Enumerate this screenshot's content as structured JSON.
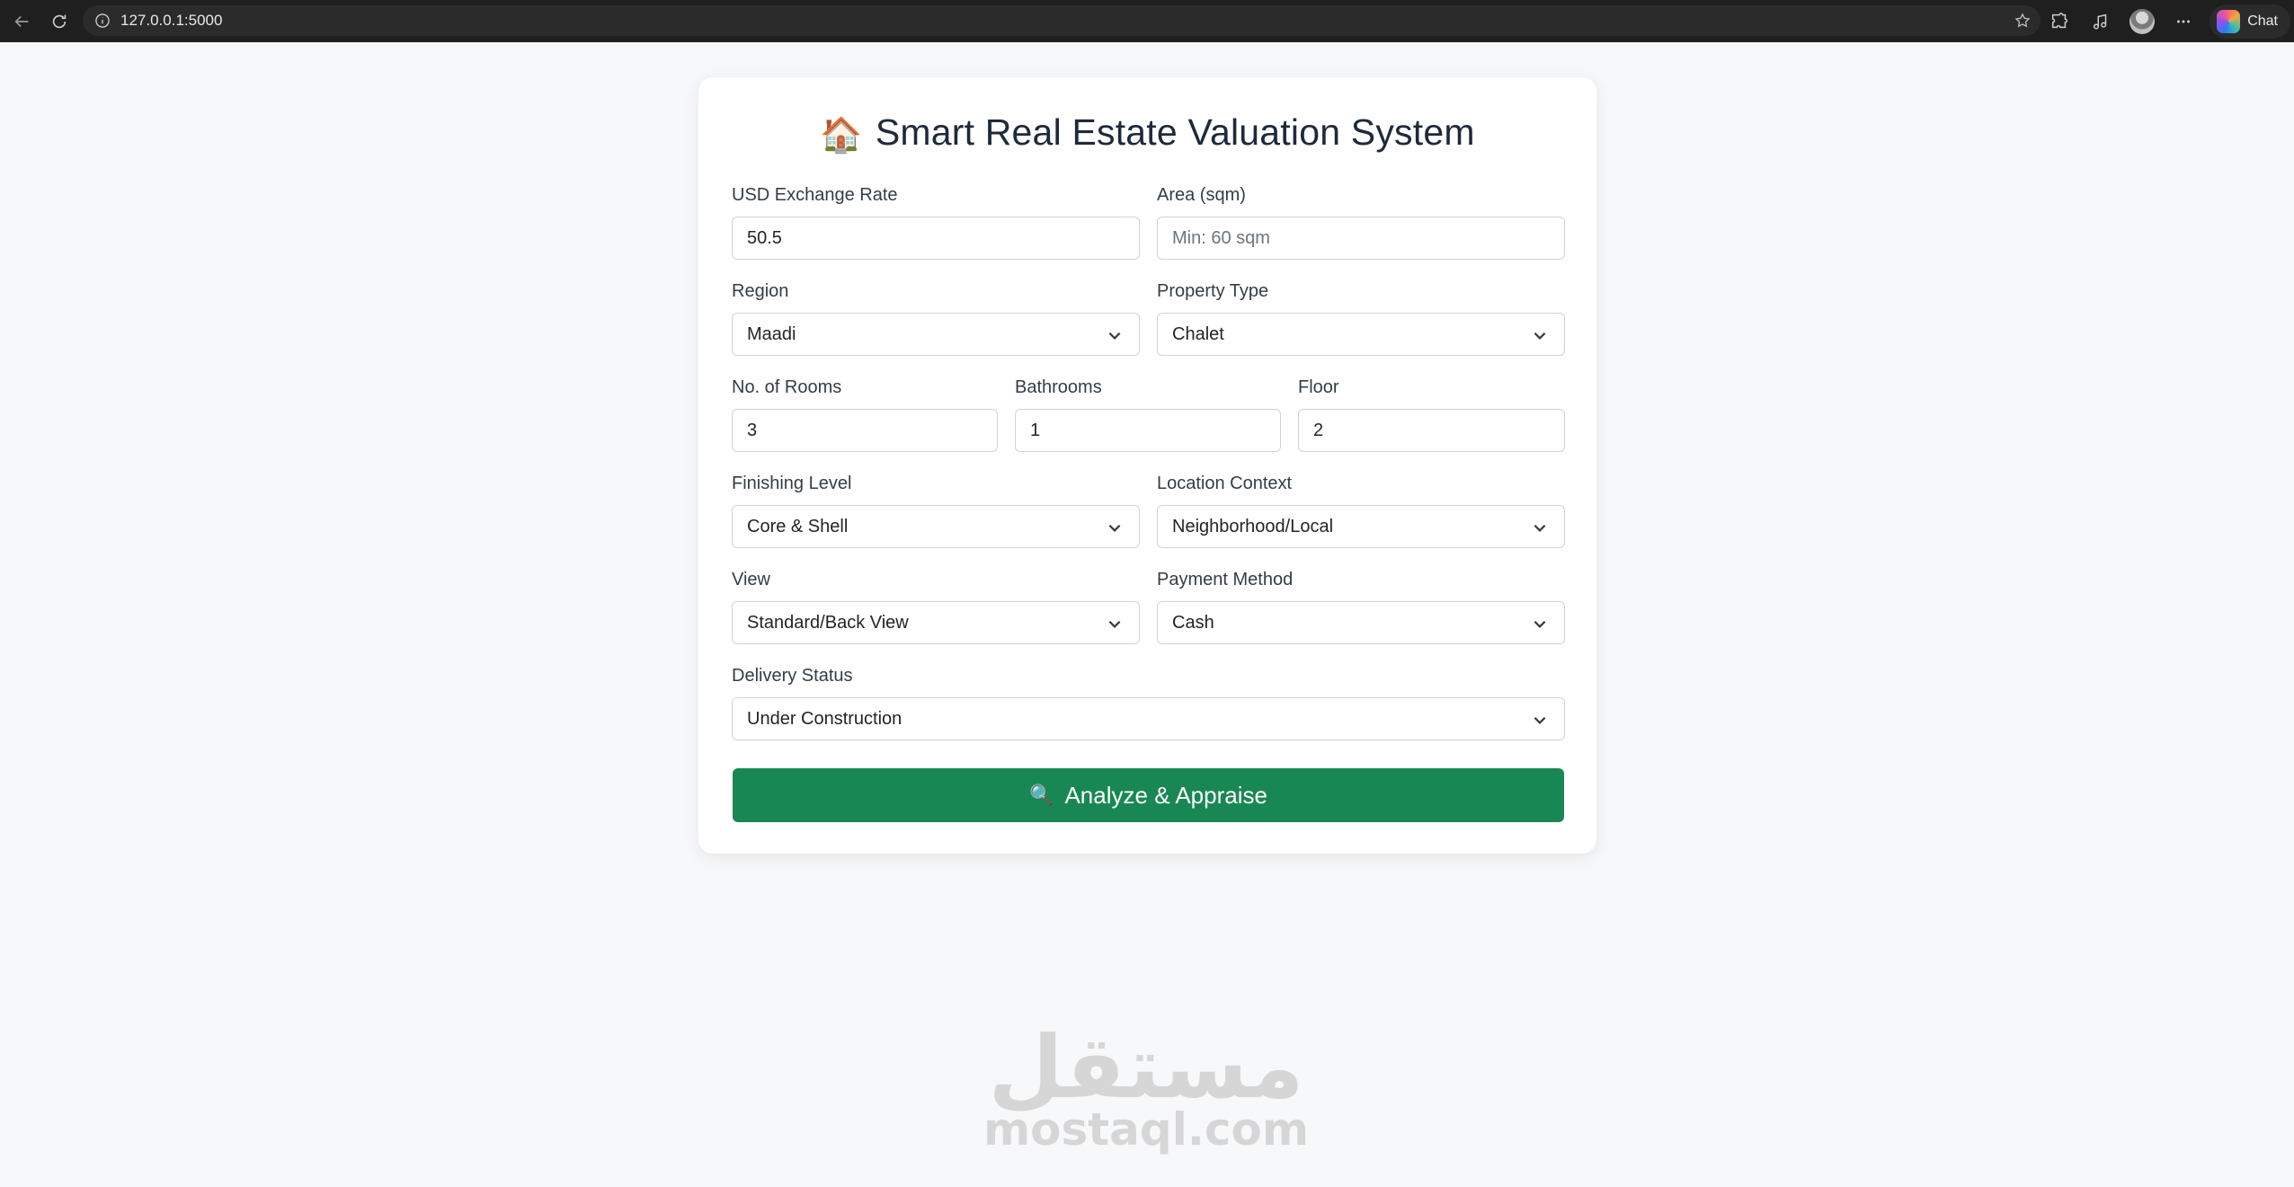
{
  "browser": {
    "url": "127.0.0.1:5000",
    "chat_label": "Chat"
  },
  "form": {
    "title": "Smart Real Estate Valuation System",
    "title_icon": "🏠",
    "fields": {
      "usd_rate": {
        "label": "USD Exchange Rate",
        "value": "50.5"
      },
      "area": {
        "label": "Area (sqm)",
        "placeholder": "Min: 60 sqm",
        "value": ""
      },
      "region": {
        "label": "Region",
        "value": "Maadi"
      },
      "property_type": {
        "label": "Property Type",
        "value": "Chalet"
      },
      "rooms": {
        "label": "No. of Rooms",
        "value": "3"
      },
      "bathrooms": {
        "label": "Bathrooms",
        "value": "1"
      },
      "floor": {
        "label": "Floor",
        "value": "2"
      },
      "finishing": {
        "label": "Finishing Level",
        "value": "Core & Shell"
      },
      "location": {
        "label": "Location Context",
        "value": "Neighborhood/Local"
      },
      "view": {
        "label": "View",
        "value": "Standard/Back View"
      },
      "payment": {
        "label": "Payment Method",
        "value": "Cash"
      },
      "delivery": {
        "label": "Delivery Status",
        "value": "Under Construction"
      }
    },
    "submit": {
      "icon": "🔍",
      "label": "Analyze & Appraise"
    }
  },
  "watermark": {
    "arabic": "مستقل",
    "latin": "mostaql.com"
  },
  "colors": {
    "accent": "#198754",
    "title": "#1e2a3a",
    "page_bg": "#f7f8fa"
  }
}
